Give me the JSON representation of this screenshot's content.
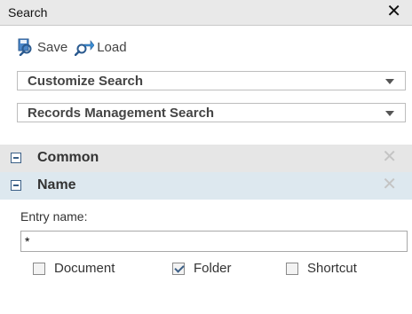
{
  "window": {
    "title": "Search",
    "close_glyph": "✕"
  },
  "toolbar": {
    "save_label": "Save",
    "load_label": "Load",
    "save_icon": "save-search-icon",
    "load_icon": "load-search-icon"
  },
  "dropdowns": [
    {
      "label": "Customize Search"
    },
    {
      "label": "Records Management Search"
    }
  ],
  "sections": [
    {
      "title": "Common",
      "expanded": true
    },
    {
      "title": "Name",
      "expanded": true
    }
  ],
  "section_remove_glyph": "✕",
  "name_section": {
    "entry_label": "Entry name:",
    "entry_value": "*",
    "checkboxes": [
      {
        "label": "Document",
        "checked": false
      },
      {
        "label": "Folder",
        "checked": true
      },
      {
        "label": "Shortcut",
        "checked": false
      }
    ]
  },
  "colors": {
    "icon_blue": "#3a6fb0",
    "section_common_bg": "#e6e6e6",
    "section_name_bg": "#dde8ef"
  }
}
